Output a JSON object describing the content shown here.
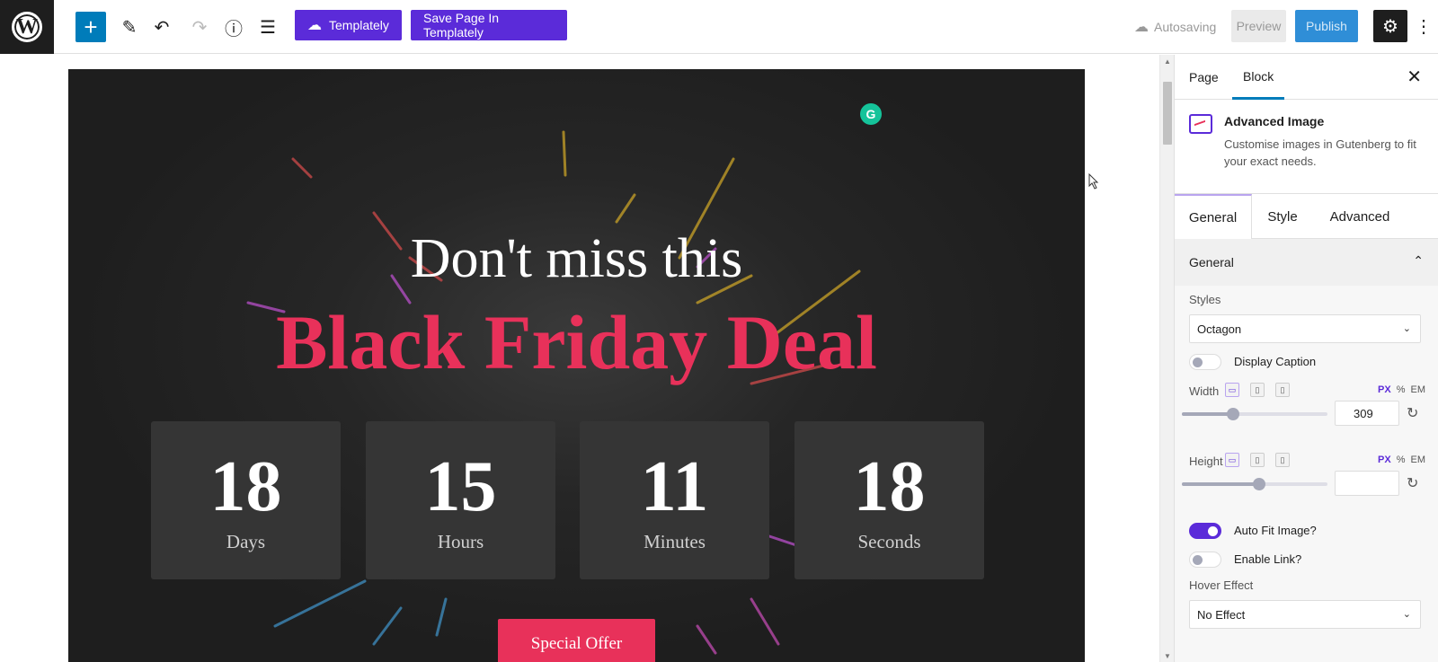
{
  "toolbar": {
    "logo_glyph": "W",
    "add_glyph": "+",
    "edit_glyph": "✎",
    "undo_glyph": "↶",
    "redo_glyph": "↷",
    "info_glyph": "ⓘ",
    "list_glyph": "☰",
    "templately_label": "Templately",
    "save_templately_label": "Save Page In Templately",
    "autosave_label": "Autosaving",
    "autosave_icon": "☁",
    "preview_label": "Preview",
    "publish_label": "Publish",
    "settings_glyph": "⚙",
    "more_glyph": "⋮"
  },
  "canvas": {
    "grammarly_glyph": "G",
    "heading": "Don't miss this",
    "deal_heading": "Black Friday Deal",
    "countdown": [
      {
        "value": "18",
        "label": "Days"
      },
      {
        "value": "15",
        "label": "Hours"
      },
      {
        "value": "11",
        "label": "Minutes"
      },
      {
        "value": "18",
        "label": "Seconds"
      }
    ],
    "offer_button": "Special Offer"
  },
  "sidebar": {
    "tabs": [
      "Page",
      "Block"
    ],
    "close_glyph": "✕",
    "block_title": "Advanced Image",
    "block_desc": "Customise images in Gutenberg to fit your exact needs.",
    "settings_tabs": [
      "General",
      "Style",
      "Advanced"
    ],
    "section_title": "General",
    "section_chevron": "⌃",
    "styles_label": "Styles",
    "styles_value": "Octagon",
    "display_caption_label": "Display Caption",
    "display_caption_on": false,
    "width_label": "Width",
    "width_value": "309",
    "width_slider_fraction": 0.35,
    "height_label": "Height",
    "height_value": "",
    "height_slider_fraction": 0.53,
    "units": [
      "PX",
      "%",
      "EM"
    ],
    "auto_fit_label": "Auto Fit Image?",
    "auto_fit_on": true,
    "enable_link_label": "Enable Link?",
    "enable_link_on": false,
    "hover_effect_label": "Hover Effect",
    "hover_effect_value": "No Effect",
    "chevron_glyph": "⌄",
    "reset_glyph": "↻",
    "desktop_glyph": "▭",
    "tablet_glyph": "▯",
    "mobile_glyph": "▯"
  },
  "colors": {
    "accent_purple": "#5b2bd9",
    "deal_pink": "#e8315a",
    "wp_blue": "#007cba"
  }
}
